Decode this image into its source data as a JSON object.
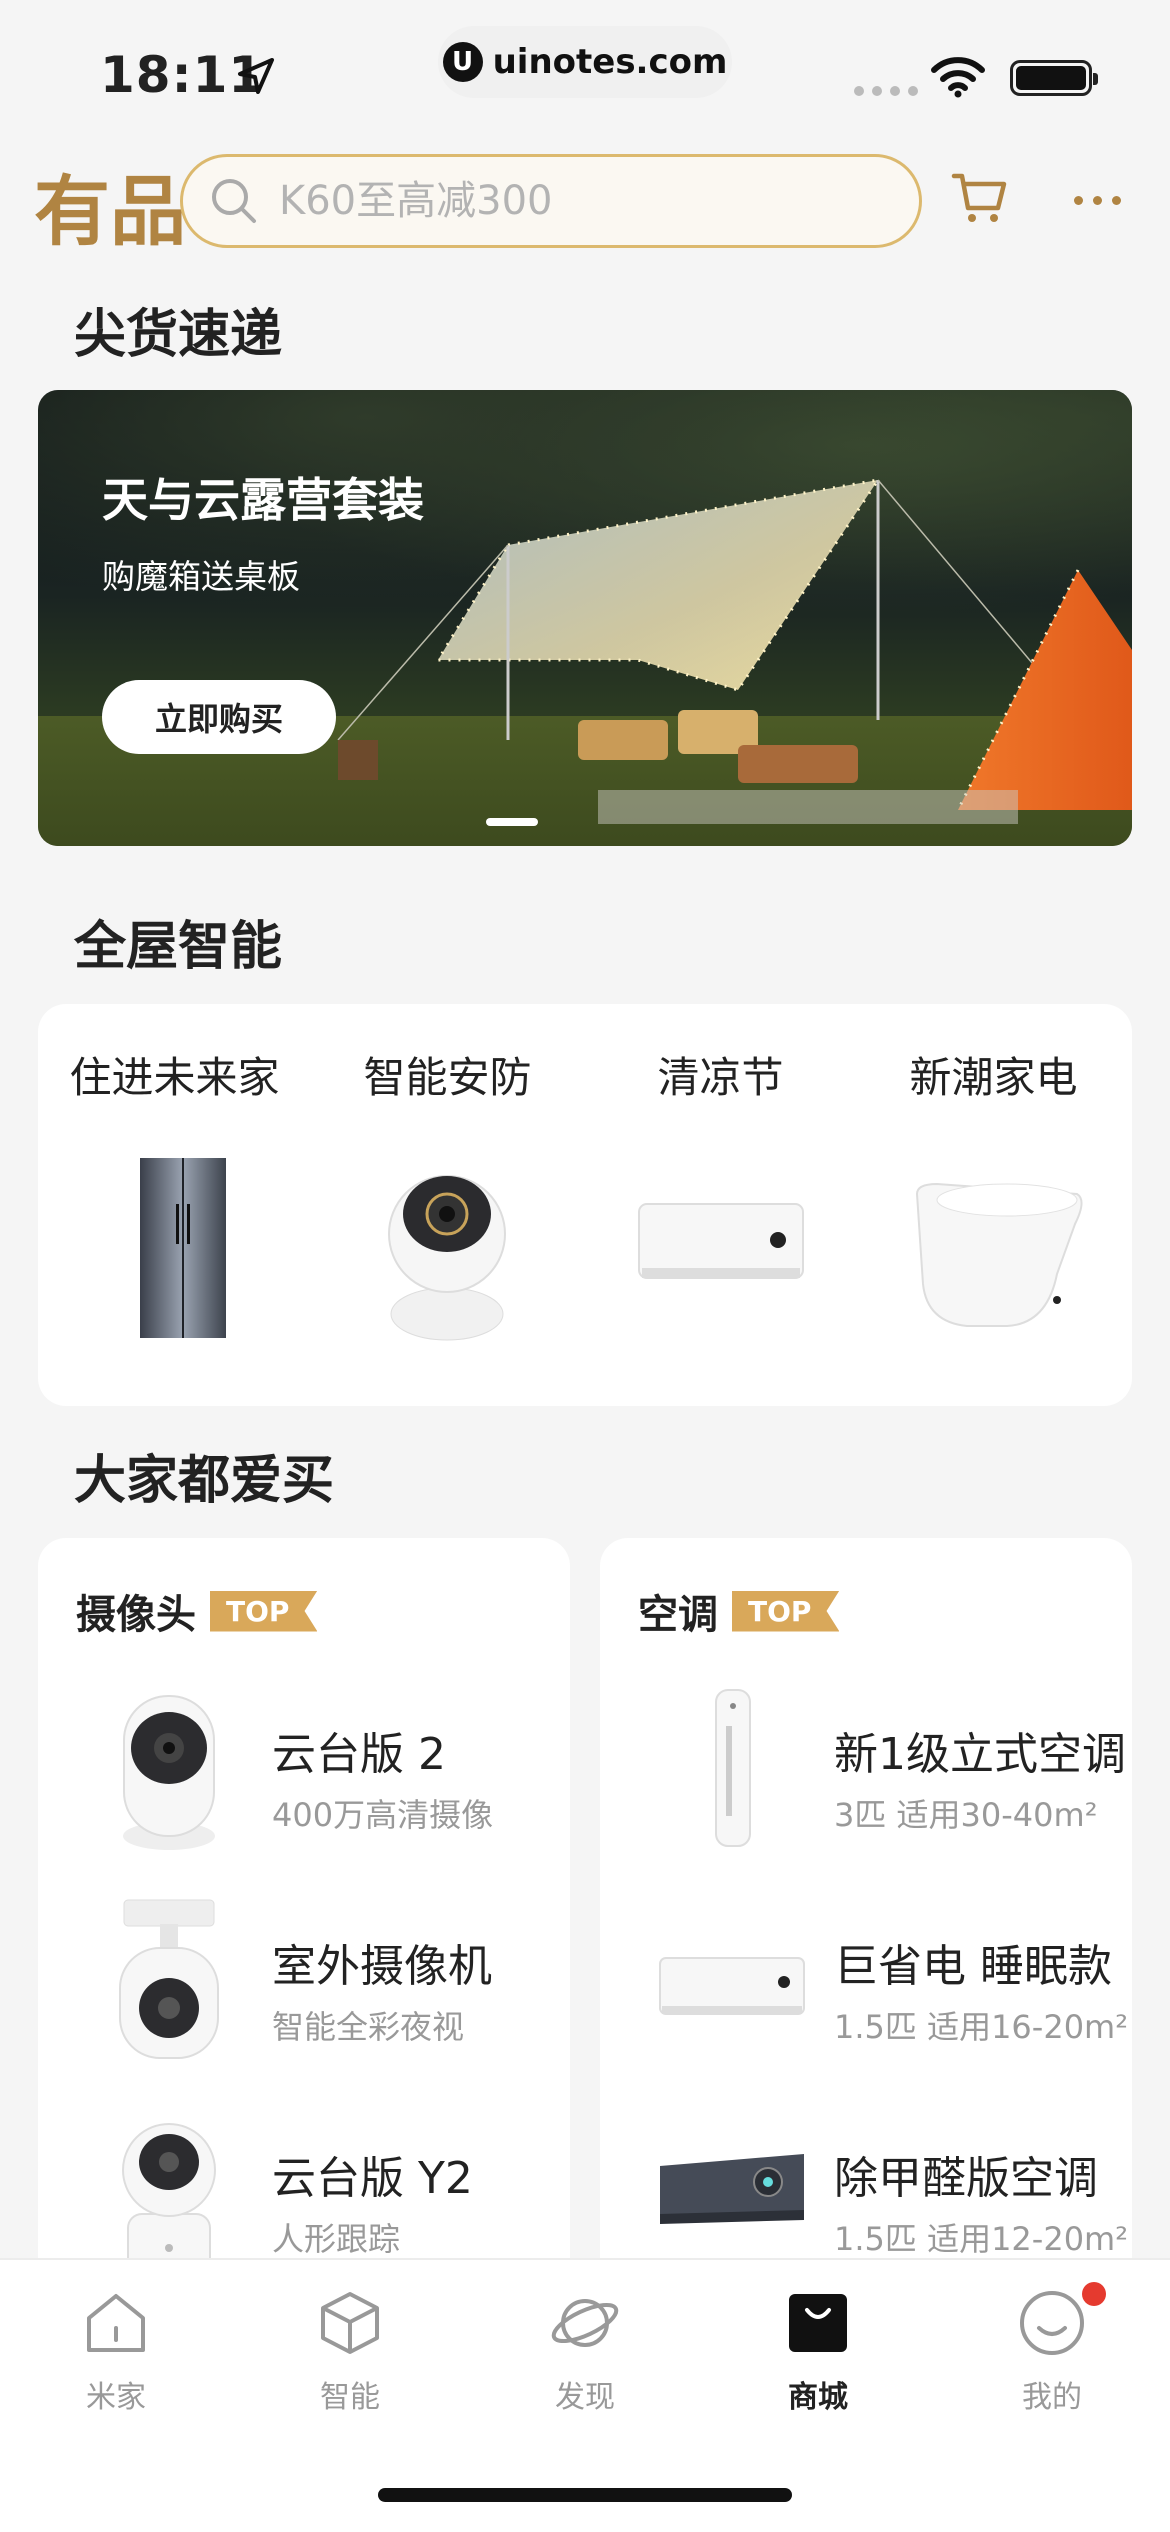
{
  "status": {
    "time": "18:11",
    "url": "uinotes.com"
  },
  "header": {
    "logo": "有品",
    "search_placeholder": "K60至高减300"
  },
  "sections": {
    "express": "尖货速递",
    "whole_house": "全屋智能",
    "popular": "大家都爱买"
  },
  "banner": {
    "title": "天与云露营套装",
    "subtitle": "购魔箱送桌板",
    "button": "立即购买"
  },
  "whole_house_items": [
    {
      "label": "住进未来家",
      "icon": "refrigerator"
    },
    {
      "label": "智能安防",
      "icon": "security-camera"
    },
    {
      "label": "清凉节",
      "icon": "air-conditioner"
    },
    {
      "label": "新潮家电",
      "icon": "smart-toilet"
    }
  ],
  "popular": [
    {
      "category": "摄像头",
      "badge": "TOP",
      "items": [
        {
          "name": "云台版 2",
          "desc": "400万高清摄像",
          "icon": "ptz-camera"
        },
        {
          "name": "室外摄像机",
          "desc": "智能全彩夜视",
          "icon": "outdoor-camera"
        },
        {
          "name": "云台版 Y2",
          "desc": "人形跟踪",
          "icon": "ptz-camera-y2"
        }
      ]
    },
    {
      "category": "空调",
      "badge": "TOP",
      "items": [
        {
          "name": "新1级立式空调",
          "desc": "3匹 适用30-40m²",
          "icon": "standing-ac"
        },
        {
          "name": "巨省电 睡眠款",
          "desc": "1.5匹 适用16-20m²",
          "icon": "wall-ac"
        },
        {
          "name": "除甲醛版空调",
          "desc": "1.5匹 适用12-20m²",
          "icon": "wall-ac-dark"
        }
      ]
    }
  ],
  "tabbar": [
    {
      "label": "米家",
      "icon": "home-icon",
      "active": false
    },
    {
      "label": "智能",
      "icon": "cube-icon",
      "active": false
    },
    {
      "label": "发现",
      "icon": "planet-icon",
      "active": false
    },
    {
      "label": "商城",
      "icon": "shopping-bag-icon",
      "active": true
    },
    {
      "label": "我的",
      "icon": "smile-icon",
      "active": false
    }
  ],
  "colors": {
    "accent": "#b08442",
    "badge": "#d9a85a",
    "notify": "#e53a2f"
  }
}
